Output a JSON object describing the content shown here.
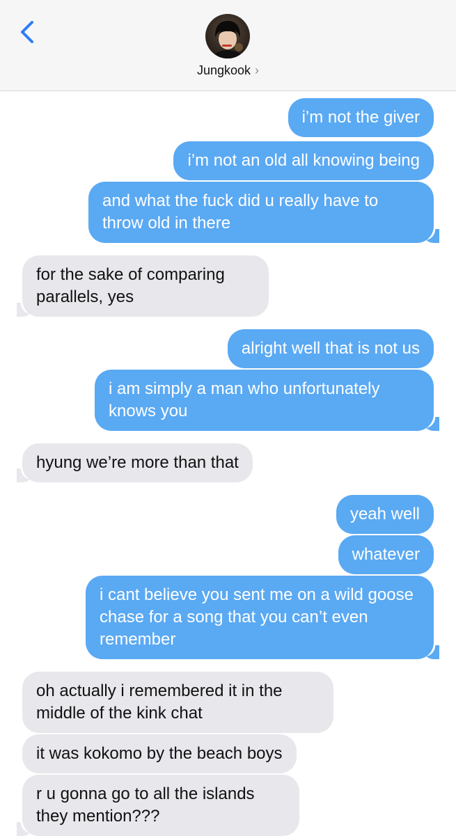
{
  "header": {
    "contact_name": "Jungkook",
    "chevron": "›",
    "back_icon": "chevron-left-icon"
  },
  "colors": {
    "outgoing_bubble": "#5aa9f3",
    "incoming_bubble": "#e7e7ec",
    "accent": "#2f7cf6"
  },
  "messages": [
    {
      "from": "me",
      "text": "i’m not the giver"
    },
    {
      "from": "me",
      "text": "i’m not an old all knowing being"
    },
    {
      "from": "me",
      "text": "and what the fuck did u really have to throw old in there"
    },
    {
      "from": "them",
      "text": "for the sake of comparing parallels, yes"
    },
    {
      "from": "me",
      "text": "alright well that is not us"
    },
    {
      "from": "me",
      "text": "i am simply a man who unfortunately knows you"
    },
    {
      "from": "them",
      "text": "hyung we’re more than that"
    },
    {
      "from": "me",
      "text": "yeah well"
    },
    {
      "from": "me",
      "text": "whatever"
    },
    {
      "from": "me",
      "text": "i cant believe you sent me on a wild goose chase for a song that you can’t even remember"
    },
    {
      "from": "them",
      "text": "oh actually i remembered it in the middle of the kink chat"
    },
    {
      "from": "them",
      "text": "it was kokomo by the beach boys"
    },
    {
      "from": "them",
      "text": "r u gonna go to all the islands they mention???"
    }
  ]
}
